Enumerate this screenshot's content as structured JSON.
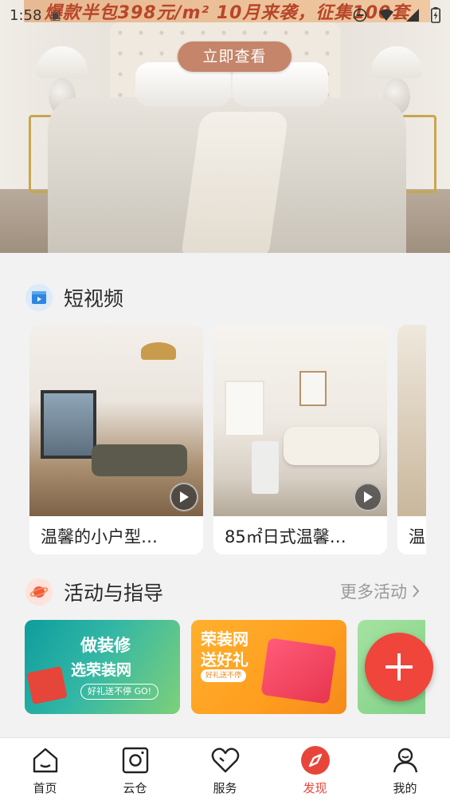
{
  "status_bar": {
    "time": "1:58"
  },
  "hero": {
    "promo_text": "爆款半包398元/m²  10月来袭，征集100套",
    "cta_label": "立即查看"
  },
  "video_section": {
    "title": "短视频",
    "icon": "clapperboard-icon",
    "items": [
      {
        "title": "温馨的小户型…"
      },
      {
        "title": "85㎡日式温馨…"
      },
      {
        "title": "温"
      }
    ]
  },
  "activity_section": {
    "title": "活动与指导",
    "icon": "planet-icon",
    "more_label": "更多活动",
    "cards": [
      {
        "line1": "做装修",
        "line2": "选荣装网",
        "pill": "好礼送不停  GO!"
      },
      {
        "line1": "荣装网",
        "line2": "送好礼",
        "pill": "好礼送不停"
      }
    ]
  },
  "fab": {
    "icon": "plus-icon"
  },
  "bottom_nav": {
    "items": [
      {
        "label": "首页",
        "icon": "home-icon"
      },
      {
        "label": "云仓",
        "icon": "warehouse-icon"
      },
      {
        "label": "服务",
        "icon": "heart-icon"
      },
      {
        "label": "发现",
        "icon": "compass-icon",
        "active": true
      },
      {
        "label": "我的",
        "icon": "user-icon"
      }
    ],
    "active_color": "#e8453a"
  },
  "colors": {
    "accent": "#f0453b",
    "cta": "#c4856a"
  }
}
